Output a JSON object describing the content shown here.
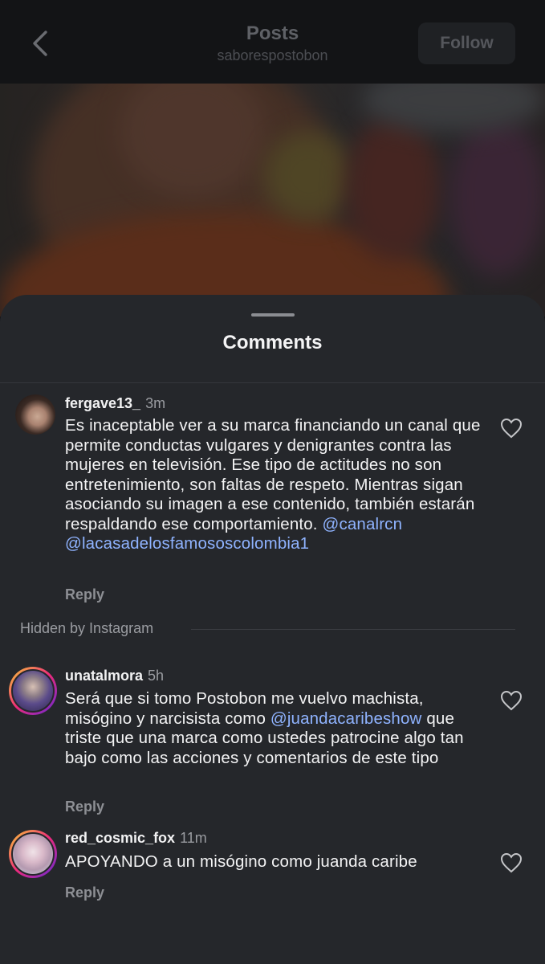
{
  "nav": {
    "title": "Posts",
    "subtitle": "saborespostobon",
    "follow_label": "Follow"
  },
  "sheet": {
    "title": "Comments"
  },
  "comments": [
    {
      "username": "fergave13_",
      "time": "3m",
      "text": "Es inaceptable ver a su marca financiando un canal que permite conductas vulgares y denigrantes contra las mujeres en televisión. Ese tipo de actitudes no son entretenimiento, son faltas de respeto. Mientras sigan asociando su imagen a ese contenido, también estarán respaldando ese comportamiento.",
      "mention_1": "@canalrcn",
      "mention_2": "@lacasadelosfamososcolombia1",
      "reply_label": "Reply"
    },
    {
      "username": "unatalmora",
      "time": "5h",
      "text_before": "Será que si tomo Postobon me vuelvo machista, misógino y narcisista como",
      "mention": "@juandacaribeshow",
      "text_after": "que triste que una marca como ustedes patrocine algo tan bajo como las acciones y comentarios de este tipo",
      "reply_label": "Reply"
    },
    {
      "username": "red_cosmic_fox",
      "time": "11m",
      "text": "APOYANDO a un misógino como juanda caribe",
      "reply_label": "Reply"
    }
  ],
  "hidden": {
    "label": "Hidden by Instagram"
  },
  "colors": {
    "sheet_bg": "#25272b",
    "mention": "#8fb3ff",
    "story_ring": [
      "#f9ce34",
      "#ee2a7b",
      "#6228d7"
    ]
  },
  "icons": {
    "back": "chevron-left-icon",
    "like": "heart-outline-icon"
  }
}
